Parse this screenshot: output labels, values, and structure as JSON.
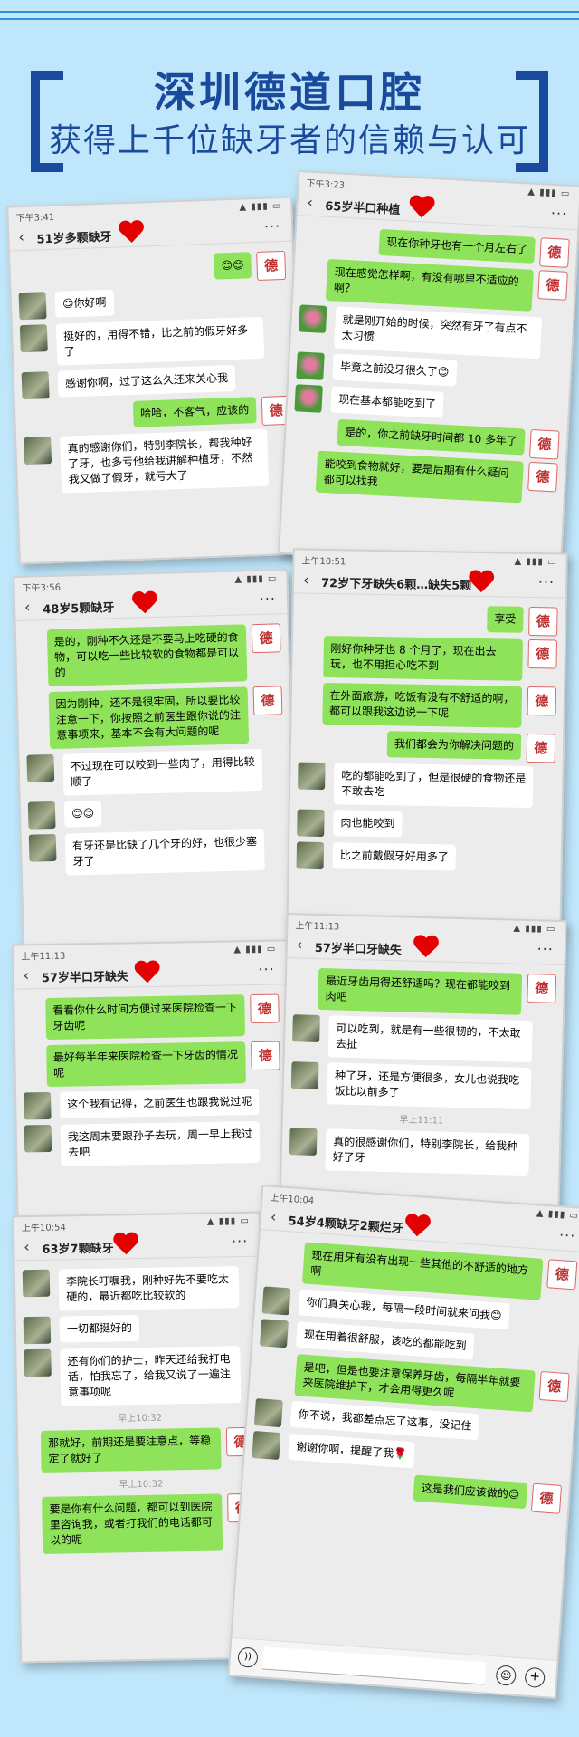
{
  "header": {
    "title": "深圳德道口腔",
    "subtitle": "获得上千位缺牙者的信赖与认可"
  },
  "avatar_char": "德",
  "cards": [
    {
      "time": "下午3:41",
      "title": "51岁多颗缺牙",
      "messages": [
        {
          "side": "me",
          "text": "😊😊"
        },
        {
          "side": "them",
          "text": "😊你好啊"
        },
        {
          "side": "them",
          "text": "挺好的，用得不错，比之前的假牙好多了"
        },
        {
          "side": "them",
          "text": "感谢你啊，过了这么久还来关心我"
        },
        {
          "side": "me",
          "text": "哈哈，不客气，应该的"
        },
        {
          "side": "them",
          "text": "真的感谢你们，特别李院长，帮我种好了牙，也多亏他给我讲解种植牙，不然我又做了假牙，就亏大了"
        }
      ]
    },
    {
      "time": "下午3:23",
      "title": "65岁半口种植",
      "messages": [
        {
          "side": "me",
          "text": "现在你种牙也有一个月左右了"
        },
        {
          "side": "me",
          "text": "现在感觉怎样啊，有没有哪里不适应的啊？"
        },
        {
          "side": "them",
          "text": "就是刚开始的时候，突然有牙了有点不太习惯",
          "flower": true
        },
        {
          "side": "them",
          "text": "毕竟之前没牙很久了😊",
          "flower": true
        },
        {
          "side": "them",
          "text": "现在基本都能吃到了",
          "flower": true
        },
        {
          "side": "me",
          "text": "是的，你之前缺牙时间都 10 多年了"
        },
        {
          "side": "me",
          "text": "能咬到食物就好，要是后期有什么疑问都可以找我"
        }
      ]
    },
    {
      "time": "下午3:56",
      "title": "48岁5颗缺牙",
      "messages": [
        {
          "side": "me",
          "text": "是的，刚种不久还是不要马上吃硬的食物，可以吃一些比较软的食物都是可以的"
        },
        {
          "side": "me",
          "text": "因为刚种，还不是很牢固，所以要比较注意一下，你按照之前医生跟你说的注意事项来，基本不会有大问题的呢"
        },
        {
          "side": "them",
          "text": "不过现在可以咬到一些肉了，用得比较顺了"
        },
        {
          "side": "them",
          "text": "😊😊"
        },
        {
          "side": "them",
          "text": "有牙还是比缺了几个牙的好，也很少塞牙了"
        }
      ]
    },
    {
      "time": "上午10:51",
      "title": "72岁下牙缺失6颗…缺失5颗",
      "messages": [
        {
          "side": "me",
          "text": "享受"
        },
        {
          "side": "me",
          "text": "刚好你种牙也 8 个月了，现在出去玩，也不用担心吃不到"
        },
        {
          "side": "me",
          "text": "在外面旅游，吃饭有没有不舒适的啊，都可以跟我这边说一下呢"
        },
        {
          "side": "me",
          "text": "我们都会为你解决问题的"
        },
        {
          "side": "them",
          "text": "吃的都能吃到了，但是很硬的食物还是不敢去吃"
        },
        {
          "side": "them",
          "text": "肉也能咬到"
        },
        {
          "side": "them",
          "text": "比之前戴假牙好用多了"
        }
      ]
    },
    {
      "time": "上午11:13",
      "title": "57岁半口牙缺失",
      "messages": [
        {
          "side": "me",
          "text": "看看你什么时间方便过来医院检查一下牙齿呢"
        },
        {
          "side": "me",
          "text": "最好每半年来医院检查一下牙齿的情况呢"
        },
        {
          "side": "them",
          "text": "这个我有记得，之前医生也跟我说过呢"
        },
        {
          "side": "them",
          "text": "我这周末要跟孙子去玩，周一早上我过去吧"
        }
      ]
    },
    {
      "time": "上午11:13",
      "title": "57岁半口牙缺失",
      "messages": [
        {
          "side": "me",
          "text": "最近牙齿用得还舒适吗？现在都能咬到肉吧"
        },
        {
          "side": "them",
          "text": "可以吃到，就是有一些很韧的，不太敢去扯"
        },
        {
          "side": "them",
          "text": "种了牙，还是方便很多，女儿也说我吃饭比以前多了"
        },
        {
          "ts": "早上11:11"
        },
        {
          "side": "them",
          "text": "真的很感谢你们，特别李院长，给我种好了牙"
        }
      ]
    },
    {
      "time": "上午10:54",
      "title": "63岁7颗缺牙",
      "messages": [
        {
          "side": "them",
          "text": "李院长叮嘱我，刚种好先不要吃太硬的，最近都吃比较软的"
        },
        {
          "side": "them",
          "text": "一切都挺好的"
        },
        {
          "side": "them",
          "text": "还有你们的护士，昨天还给我打电话，怕我忘了，给我又说了一遍注意事项呢"
        },
        {
          "ts": "早上10:32"
        },
        {
          "side": "me",
          "text": "那就好，前期还是要注意点，等稳定了就好了"
        },
        {
          "ts": "早上10:32"
        },
        {
          "side": "me",
          "text": "要是你有什么问题，都可以到医院里咨询我，或者打我们的电话都可以的呢"
        }
      ]
    },
    {
      "time": "上午10:04",
      "title": "54岁4颗缺牙2颗烂牙",
      "messages": [
        {
          "side": "me",
          "text": "现在用牙有没有出现一些其他的不舒适的地方啊"
        },
        {
          "side": "them",
          "text": "你们真关心我，每隔一段时间就来问我😊"
        },
        {
          "side": "them",
          "text": "现在用着很舒服，该吃的都能吃到"
        },
        {
          "side": "me",
          "text": "是吧，但是也要注意保养牙齿，每隔半年就要来医院维护下，才会用得更久呢"
        },
        {
          "side": "them",
          "text": "你不说，我都差点忘了这事，没记住"
        },
        {
          "side": "them",
          "text": "谢谢你啊，提醒了我🌹"
        },
        {
          "side": "me",
          "text": "这是我们应该做的😊"
        }
      ]
    }
  ]
}
